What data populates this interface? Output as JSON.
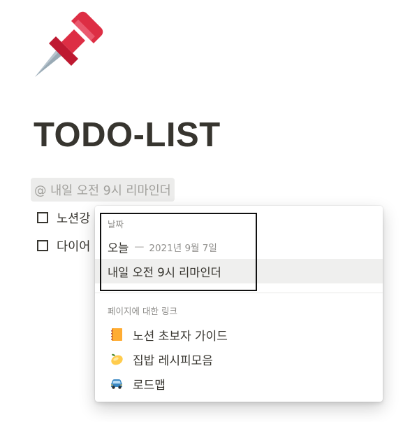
{
  "page": {
    "icon": "pushpin-icon",
    "title": "TODO-LIST"
  },
  "mention": {
    "text": "@ 내일 오전 9시 리마인더"
  },
  "todos": [
    {
      "text": "노션강",
      "checked": false
    },
    {
      "text": "다이어",
      "checked": false
    }
  ],
  "popup": {
    "date_section_label": "날짜",
    "today_label": "오늘",
    "today_dash": "—",
    "today_date": "2021년 9월 7일",
    "reminder_label": "내일 오전 9시 리마인더",
    "links_section_label": "페이지에 대한 링크",
    "links": [
      {
        "label": "노션 초보자 가이드",
        "icon": "notebook-icon"
      },
      {
        "label": "집밥 레시피모음",
        "icon": "lemon-icon"
      },
      {
        "label": "로드맵",
        "icon": "car-icon"
      }
    ]
  },
  "colors": {
    "text": "#37352f",
    "muted": "#8f8e8b",
    "chip_bg": "#ececeb",
    "hover_bg": "#efefee",
    "pin_red": "#dd2e44",
    "outline": "#111111"
  }
}
